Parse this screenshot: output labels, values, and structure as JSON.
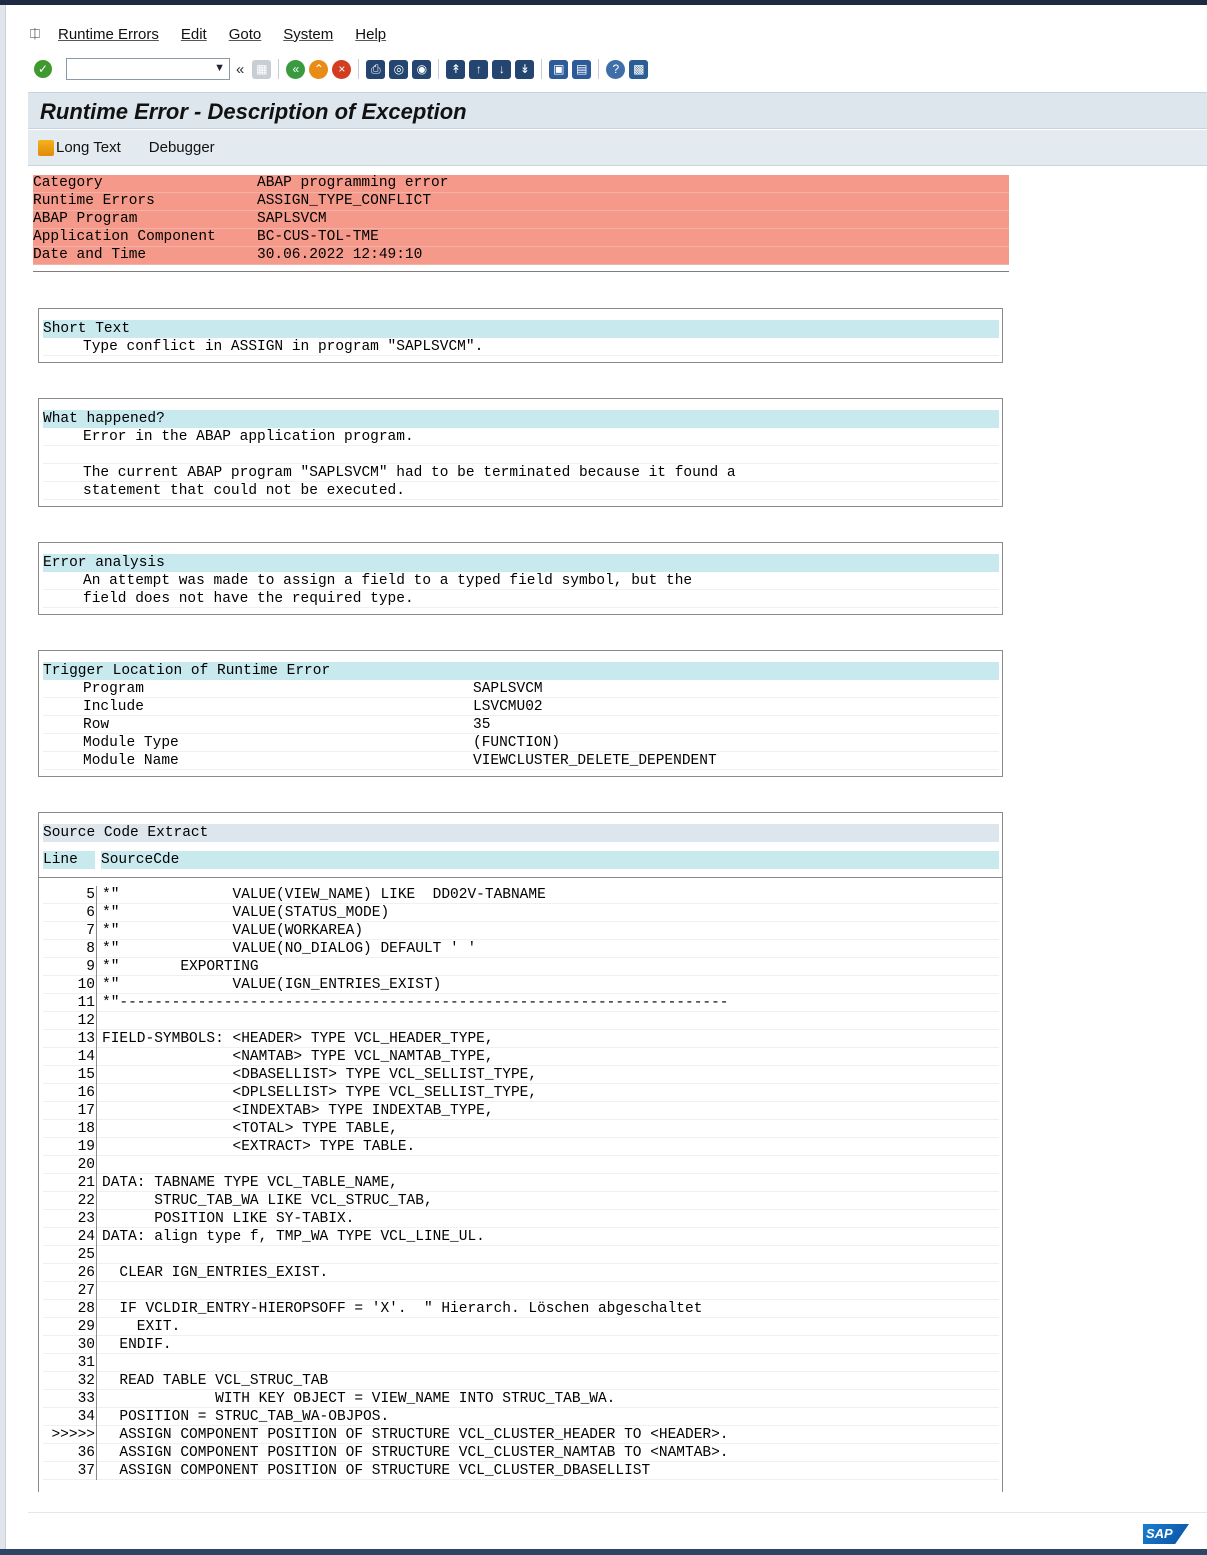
{
  "menu": {
    "items": [
      "Runtime Errors",
      "Edit",
      "Goto",
      "System",
      "Help"
    ]
  },
  "toolbar": {
    "command_value": "",
    "icons": [
      "ok-icon",
      "save-icon",
      "back-icon",
      "exit-icon",
      "cancel-icon",
      "print-icon",
      "find-icon",
      "find-next-icon",
      "first-page-icon",
      "previous-page-icon",
      "next-page-icon",
      "last-page-icon",
      "create-session-icon",
      "shortcut-icon",
      "help-icon",
      "customize-icon"
    ]
  },
  "title": "Runtime Error - Description of Exception",
  "app_toolbar": {
    "long_text": "Long Text",
    "debugger": "Debugger"
  },
  "header": [
    {
      "label": "Category",
      "value": "ABAP programming error"
    },
    {
      "label": "Runtime Errors",
      "value": "ASSIGN_TYPE_CONFLICT"
    },
    {
      "label": "ABAP Program",
      "value": "SAPLSVCM"
    },
    {
      "label": "Application Component",
      "value": "BC-CUS-TOL-TME"
    },
    {
      "label": "Date and Time",
      "value": "30.06.2022 12:49:10"
    }
  ],
  "short_text": {
    "heading": "Short Text",
    "lines": [
      "Type conflict in ASSIGN in program \"SAPLSVCM\"."
    ]
  },
  "what_happened": {
    "heading": "What happened?",
    "lines": [
      "Error in the ABAP application program.",
      "",
      "The current ABAP program \"SAPLSVCM\" had to be terminated because it found a",
      "statement that could not be executed."
    ]
  },
  "error_analysis": {
    "heading": "Error analysis",
    "lines": [
      "An attempt was made to assign a field to a typed field symbol, but the",
      "field does not have the required type."
    ]
  },
  "trigger_location": {
    "heading": "Trigger Location of Runtime Error",
    "rows": [
      {
        "label": "Program",
        "value": "SAPLSVCM"
      },
      {
        "label": "Include",
        "value": "LSVCMU02"
      },
      {
        "label": "Row",
        "value": "35"
      },
      {
        "label": "Module Type",
        "value": "(FUNCTION)"
      },
      {
        "label": "Module Name",
        "value": "VIEWCLUSTER_DELETE_DEPENDENT"
      }
    ]
  },
  "source_code": {
    "heading": "Source Code Extract",
    "col_line": "Line",
    "col_code": "SourceCde",
    "rows": [
      {
        "line": "5",
        "code": "*\"             VALUE(VIEW_NAME) LIKE  DD02V-TABNAME"
      },
      {
        "line": "6",
        "code": "*\"             VALUE(STATUS_MODE)"
      },
      {
        "line": "7",
        "code": "*\"             VALUE(WORKAREA)"
      },
      {
        "line": "8",
        "code": "*\"             VALUE(NO_DIALOG) DEFAULT ' '"
      },
      {
        "line": "9",
        "code": "*\"       EXPORTING"
      },
      {
        "line": "10",
        "code": "*\"             VALUE(IGN_ENTRIES_EXIST)"
      },
      {
        "line": "11",
        "code": "*\"----------------------------------------------------------------------"
      },
      {
        "line": "12",
        "code": ""
      },
      {
        "line": "13",
        "code": "FIELD-SYMBOLS: <HEADER> TYPE VCL_HEADER_TYPE,"
      },
      {
        "line": "14",
        "code": "               <NAMTAB> TYPE VCL_NAMTAB_TYPE,"
      },
      {
        "line": "15",
        "code": "               <DBASELLIST> TYPE VCL_SELLIST_TYPE,"
      },
      {
        "line": "16",
        "code": "               <DPLSELLIST> TYPE VCL_SELLIST_TYPE,"
      },
      {
        "line": "17",
        "code": "               <INDEXTAB> TYPE INDEXTAB_TYPE,"
      },
      {
        "line": "18",
        "code": "               <TOTAL> TYPE TABLE,"
      },
      {
        "line": "19",
        "code": "               <EXTRACT> TYPE TABLE."
      },
      {
        "line": "20",
        "code": ""
      },
      {
        "line": "21",
        "code": "DATA: TABNAME TYPE VCL_TABLE_NAME,"
      },
      {
        "line": "22",
        "code": "      STRUC_TAB_WA LIKE VCL_STRUC_TAB,"
      },
      {
        "line": "23",
        "code": "      POSITION LIKE SY-TABIX."
      },
      {
        "line": "24",
        "code": "DATA: align type f, TMP_WA TYPE VCL_LINE_UL."
      },
      {
        "line": "25",
        "code": ""
      },
      {
        "line": "26",
        "code": "  CLEAR IGN_ENTRIES_EXIST."
      },
      {
        "line": "27",
        "code": ""
      },
      {
        "line": "28",
        "code": "  IF VCLDIR_ENTRY-HIEROPSOFF = 'X'.  \" Hierarch. Löschen abgeschaltet"
      },
      {
        "line": "29",
        "code": "    EXIT."
      },
      {
        "line": "30",
        "code": "  ENDIF."
      },
      {
        "line": "31",
        "code": ""
      },
      {
        "line": "32",
        "code": "  READ TABLE VCL_STRUC_TAB"
      },
      {
        "line": "33",
        "code": "             WITH KEY OBJECT = VIEW_NAME INTO STRUC_TAB_WA."
      },
      {
        "line": "34",
        "code": "  POSITION = STRUC_TAB_WA-OBJPOS."
      },
      {
        "line": ">>>>>",
        "code": "  ASSIGN COMPONENT POSITION OF STRUCTURE VCL_CLUSTER_HEADER TO <HEADER>."
      },
      {
        "line": "36",
        "code": "  ASSIGN COMPONENT POSITION OF STRUCTURE VCL_CLUSTER_NAMTAB TO <NAMTAB>."
      },
      {
        "line": "37",
        "code": "  ASSIGN COMPONENT POSITION OF STRUCTURE VCL_CLUSTER_DBASELLIST"
      }
    ]
  },
  "logo": "SAP"
}
